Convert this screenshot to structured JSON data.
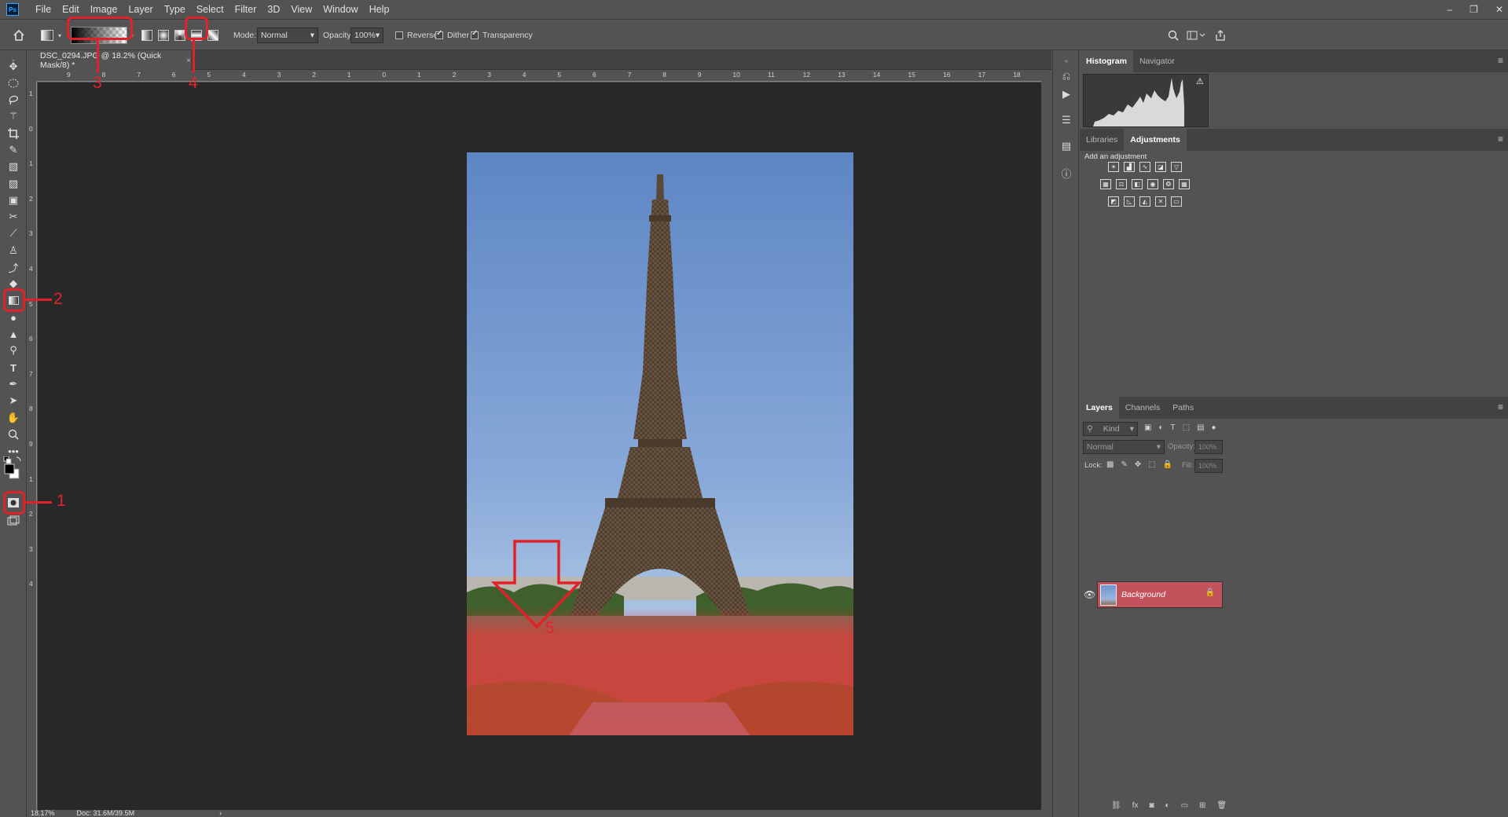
{
  "menu": {
    "app_icon": "Ps",
    "items": [
      "File",
      "Edit",
      "Image",
      "Layer",
      "Type",
      "Select",
      "Filter",
      "3D",
      "View",
      "Window",
      "Help"
    ]
  },
  "window_controls": {
    "minimize": "–",
    "restore": "❐",
    "close": "✕"
  },
  "options": {
    "mode_label": "Mode:",
    "mode_value": "Normal",
    "opacity_label": "Opacity:",
    "opacity_value": "100%",
    "reverse_label": "Reverse",
    "reverse_checked": false,
    "dither_label": "Dither",
    "dither_checked": true,
    "transparency_label": "Transparency",
    "transparency_checked": true
  },
  "document": {
    "tab_title": "DSC_0294.JPG @ 18.2% (Quick Mask/8) *",
    "close": "×"
  },
  "rulers": {
    "h_ticks": [
      "9",
      "8",
      "7",
      "6",
      "5",
      "4",
      "3",
      "2",
      "1",
      "0",
      "1",
      "2",
      "3",
      "4",
      "5",
      "6",
      "7",
      "8",
      "9",
      "10",
      "11",
      "12",
      "13",
      "14",
      "15",
      "16",
      "17",
      "18"
    ],
    "v_ticks": [
      "1",
      "0",
      "1",
      "2",
      "3",
      "4",
      "5",
      "6",
      "7",
      "8",
      "9",
      "1",
      "2",
      "3",
      "4"
    ]
  },
  "status": {
    "zoom": "18.17%",
    "doc": "Doc: 31.6M/39.5M",
    "arrow": "›"
  },
  "panels": {
    "histogram_tabs": [
      "Histogram",
      "Navigator"
    ],
    "histogram_warning": "⚠",
    "adjust_tabs": [
      "Libraries",
      "Adjustments"
    ],
    "add_adjustment": "Add an adjustment",
    "layers_tabs": [
      "Layers",
      "Channels",
      "Paths"
    ],
    "layers_filter_placeholder": "Kind",
    "blend_mode": "Normal",
    "opacity_label": "Opacity:",
    "opacity_value": "100%",
    "lock_label": "Lock:",
    "fill_label": "Fill:",
    "fill_value": "100%",
    "layer_name": "Background"
  },
  "annotations": [
    "1",
    "2",
    "3",
    "4",
    "5"
  ],
  "colors": {
    "callout": "#e1222a",
    "quick_mask_overlay": "#ff3b3b",
    "layer_selected": "#c3525c"
  }
}
